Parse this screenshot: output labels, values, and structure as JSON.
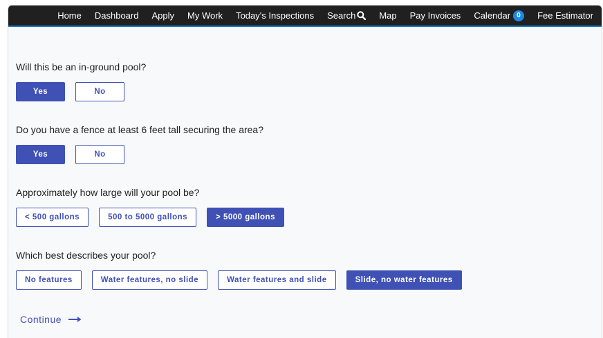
{
  "nav": {
    "items": [
      "Home",
      "Dashboard",
      "Apply",
      "My Work",
      "Today's Inspections",
      "Search",
      "Map",
      "Pay Invoices",
      "Calendar",
      "Fee Estimator"
    ],
    "calendar_count": "0",
    "icons": {
      "search": "search-icon"
    }
  },
  "questions": [
    {
      "text": "Will this be an in-ground pool?",
      "options": [
        "Yes",
        "No"
      ],
      "selected": "Yes"
    },
    {
      "text": "Do you have a fence at least 6 feet tall securing the area?",
      "options": [
        "Yes",
        "No"
      ],
      "selected": "Yes"
    },
    {
      "text": "Approximately how large will your pool be?",
      "options": [
        "< 500 gallons",
        "500 to 5000 gallons",
        "> 5000 gallons"
      ],
      "selected": "> 5000 gallons"
    },
    {
      "text": "Which best describes your pool?",
      "options": [
        "No features",
        "Water features, no slide",
        "Water features and slide",
        "Slide, no water features"
      ],
      "selected": "Slide, no water features"
    }
  ],
  "continue_label": "Continue",
  "colors": {
    "accent": "#3f51b5",
    "nav_bg": "#202020",
    "nav_underline": "#1976c7",
    "badge": "#1e88e5"
  }
}
